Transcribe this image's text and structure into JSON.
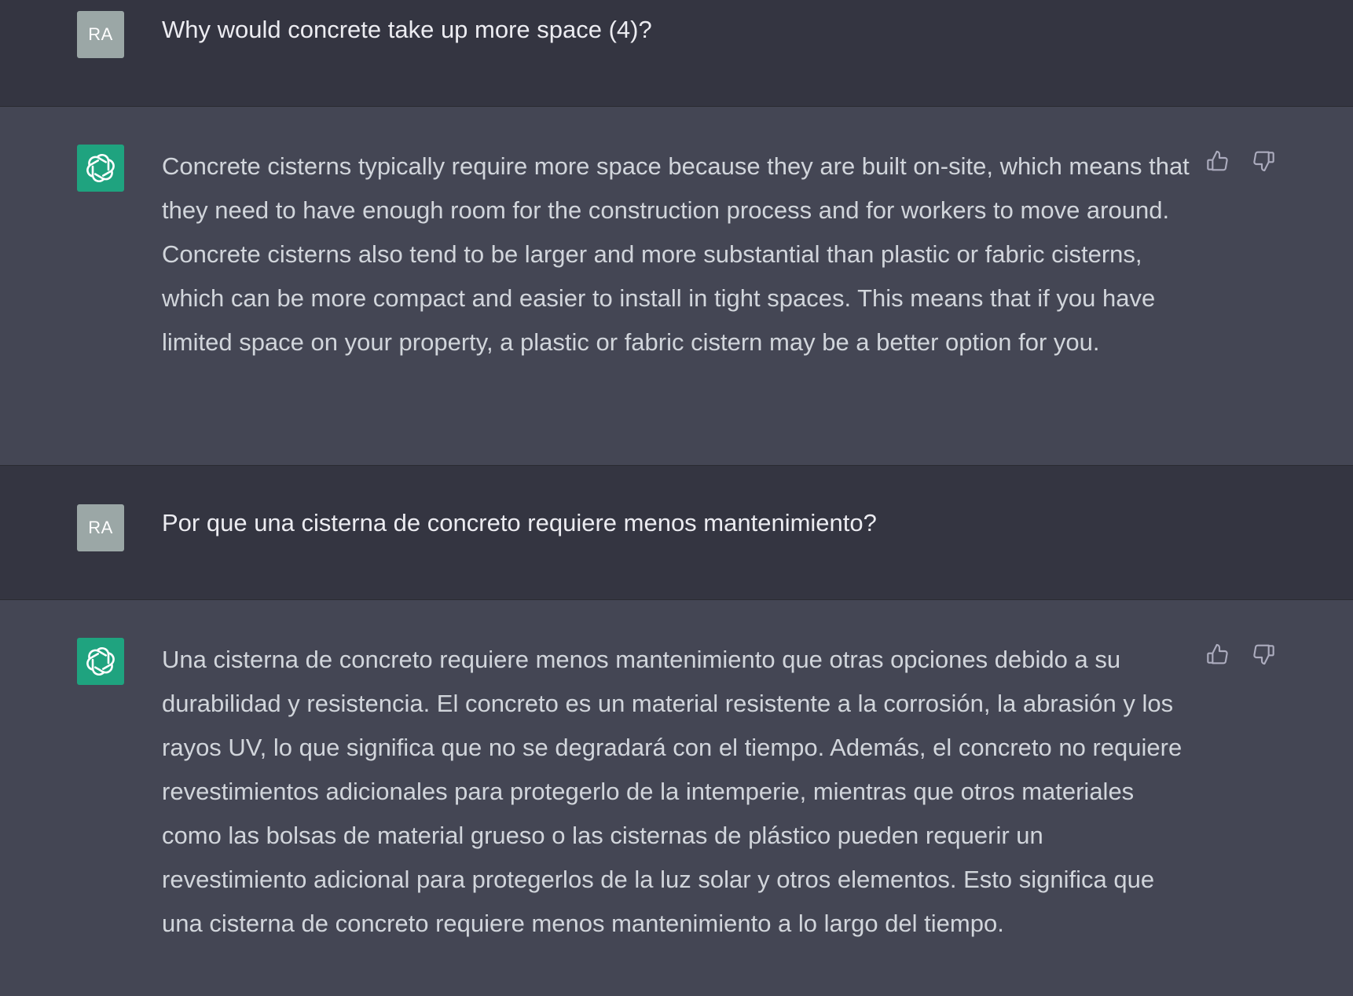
{
  "messages": [
    {
      "role": "user",
      "avatar_initials": "RA",
      "text": "Why would concrete take up more space (4)?"
    },
    {
      "role": "assistant",
      "avatar_icon": "openai-logo-icon",
      "text": "Concrete cisterns typically require more space because they are built on-site, which means that they need to have enough room for the construction process and for workers to move around. Concrete cisterns also tend to be larger and more substantial than plastic or fabric cisterns, which can be more compact and easier to install in tight spaces. This means that if you have limited space on your property, a plastic or fabric cistern may be a better option for you.",
      "actions": [
        "thumbs-up-icon",
        "thumbs-down-icon"
      ]
    },
    {
      "role": "user",
      "avatar_initials": "RA",
      "text": "Por que una cisterna de concreto requiere menos mantenimiento?"
    },
    {
      "role": "assistant",
      "avatar_icon": "openai-logo-icon",
      "text": "Una cisterna de concreto requiere menos mantenimiento que otras opciones debido a su durabilidad y resistencia. El concreto es un material resistente a la corrosión, la abrasión y los rayos UV, lo que significa que no se degradará con el tiempo. Además, el concreto no requiere revestimientos adicionales para protegerlo de la intemperie, mientras que otros materiales como las bolsas de material grueso o las cisternas de plástico pueden requerir un revestimiento adicional para protegerlos de la luz solar y otros elementos. Esto significa que una cisterna de concreto requiere menos mantenimiento a lo largo del tiempo.",
      "actions": [
        "thumbs-up-icon",
        "thumbs-down-icon"
      ]
    }
  ],
  "colors": {
    "user_bg": "#343541",
    "assistant_bg": "#444654",
    "user_avatar_bg": "#9ba7a6",
    "assistant_avatar_bg": "#1fa37f",
    "text": "#ececf1"
  }
}
